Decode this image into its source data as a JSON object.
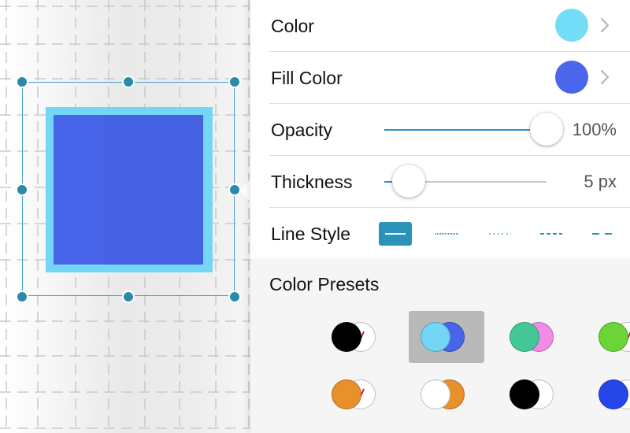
{
  "canvas": {
    "shape_stroke_color": "#73d6f5",
    "shape_fill_color": "#4864e8"
  },
  "panel": {
    "rows": {
      "color": {
        "label": "Color",
        "swatch": "#73ddf7"
      },
      "fill_color": {
        "label": "Fill Color",
        "swatch": "#4a66ea"
      },
      "opacity": {
        "label": "Opacity",
        "value": "100%",
        "level": 1.0
      },
      "thickness": {
        "label": "Thickness",
        "value": "5 px",
        "level": 0.15
      },
      "line_style": {
        "label": "Line Style",
        "options": [
          "solid",
          "fine-dotted",
          "dotted",
          "dashed",
          "long-dashed"
        ],
        "selected": "solid"
      }
    },
    "presets": {
      "title": "Color Presets",
      "items": [
        {
          "stroke": "#000000",
          "fill": "none",
          "selected": false
        },
        {
          "stroke": "#73d6f5",
          "fill": "#4864e8",
          "selected": true
        },
        {
          "stroke": "#44c796",
          "fill": "#f08ce8",
          "selected": false
        },
        {
          "stroke": "#6bd437",
          "fill": "none",
          "selected": false
        },
        {
          "stroke": "#e8902a",
          "fill": "none",
          "selected": false
        },
        {
          "stroke": "#ffffff",
          "fill": "#e8902a",
          "selected": false
        },
        {
          "stroke": "#000000",
          "fill": "#ffffff",
          "selected": false
        },
        {
          "stroke": "#2546e8",
          "fill": "#ffffff",
          "selected": false
        }
      ]
    }
  }
}
